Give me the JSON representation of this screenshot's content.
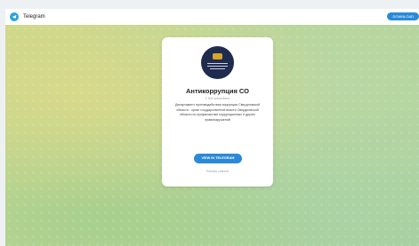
{
  "header": {
    "brand": "Telegram",
    "download_label": "DOWNLOAD"
  },
  "channel": {
    "name": "Антикоррупция СО",
    "subscribers": "2 304 subscribers",
    "description": "Департамент противодействия коррупции Свердловской области - орган государственной власти Свердловской области по профилактике коррупционных и других правонарушений",
    "view_button": "VIEW IN TELEGRAM",
    "preview_link": "Preview channel"
  },
  "colors": {
    "accent": "#2a8ad8",
    "logo": "#2aa3e0",
    "avatar_bg": "#1f2c4e",
    "emblem": "#d6a62c"
  }
}
